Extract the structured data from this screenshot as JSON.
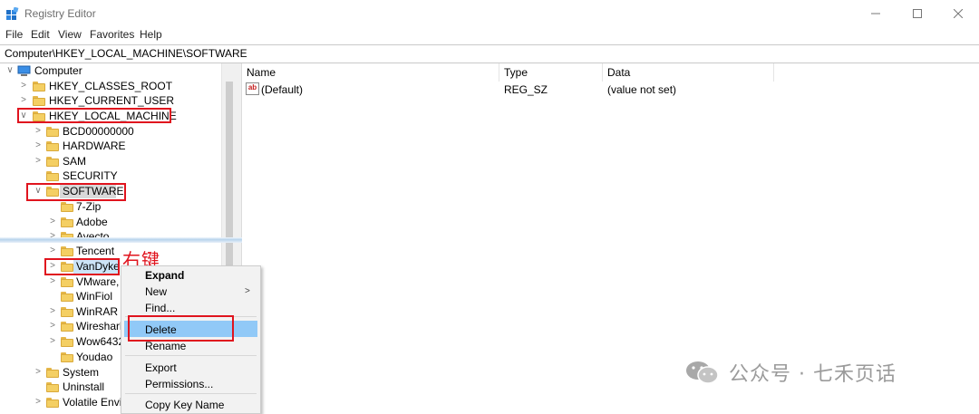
{
  "window": {
    "title": "Registry Editor",
    "app_icon": "registry-editor-icon"
  },
  "menubar": [
    "File",
    "Edit",
    "View",
    "Favorites",
    "Help"
  ],
  "address": "Computer\\HKEY_LOCAL_MACHINE\\SOFTWARE",
  "tree": {
    "root": "Computer",
    "hives": [
      "HKEY_CLASSES_ROOT",
      "HKEY_CURRENT_USER",
      "HKEY_LOCAL_MACHINE"
    ],
    "hklm_children": [
      "BCD00000000",
      "HARDWARE",
      "SAM",
      "SECURITY",
      "SOFTWARE"
    ],
    "software_children": [
      "7-Zip",
      "Adobe",
      "Avecto",
      "Tencent",
      "VanDyke",
      "VMware, I",
      "WinFiol",
      "WinRAR S",
      "Wireshark",
      "Wow6432",
      "Youdao"
    ],
    "after": [
      "System",
      "Uninstall",
      "Volatile Envir"
    ]
  },
  "list": {
    "columns": [
      "Name",
      "Type",
      "Data"
    ],
    "rows": [
      {
        "name": "(Default)",
        "type": "REG_SZ",
        "data": "(value not set)"
      }
    ]
  },
  "context_menu": {
    "items": [
      "Expand",
      "New",
      "Find...",
      "Delete",
      "Rename",
      "Export",
      "Permissions...",
      "Copy Key Name"
    ],
    "highlighted": "Delete"
  },
  "annotation": "右键",
  "watermark": "公众号 · 七禾页话",
  "colors": {
    "annotation_red": "#e0141e",
    "menu_highlight": "#91c9f7",
    "folder_yellow": "#f4cf63"
  }
}
